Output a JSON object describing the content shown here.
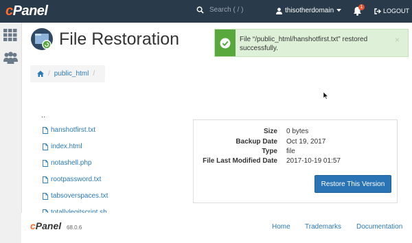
{
  "topbar": {
    "logo_c": "c",
    "logo_rest": "Panel",
    "search_placeholder": "Search ( / )",
    "username": "thisotherdomain",
    "notification_count": "1",
    "logout_label": "LOGOUT"
  },
  "page": {
    "title": "File Restoration"
  },
  "alert": {
    "message": "File “/public_html/hanshotfirst.txt” restored successfully.",
    "close": "×"
  },
  "breadcrumb": {
    "separator": "/",
    "item": "public_html"
  },
  "files": {
    "parent": "..",
    "items": [
      "hanshotfirst.txt",
      "index.html",
      "notashell.php",
      "rootpassword.txt",
      "tabsoverspaces.txt",
      "totallylegitscript.sh"
    ]
  },
  "details": {
    "size_label": "Size",
    "size_value": "0 bytes",
    "backup_label": "Backup Date",
    "backup_value": "Oct 19, 2017",
    "type_label": "Type",
    "type_value": "file",
    "modified_label": "File Last Modified Date",
    "modified_value": "2017-10-19 01:57",
    "restore_button": "Restore This Version"
  },
  "footer": {
    "logo_c": "c",
    "logo_rest": "Panel",
    "version": "68.0.6",
    "links": [
      "Home",
      "Trademarks",
      "Documentation"
    ]
  },
  "colors": {
    "topbar": "#293a4a",
    "brand_orange": "#ff6c2c",
    "success": "#58a83e",
    "primary": "#2a74b5",
    "link": "#2a7ab8"
  }
}
